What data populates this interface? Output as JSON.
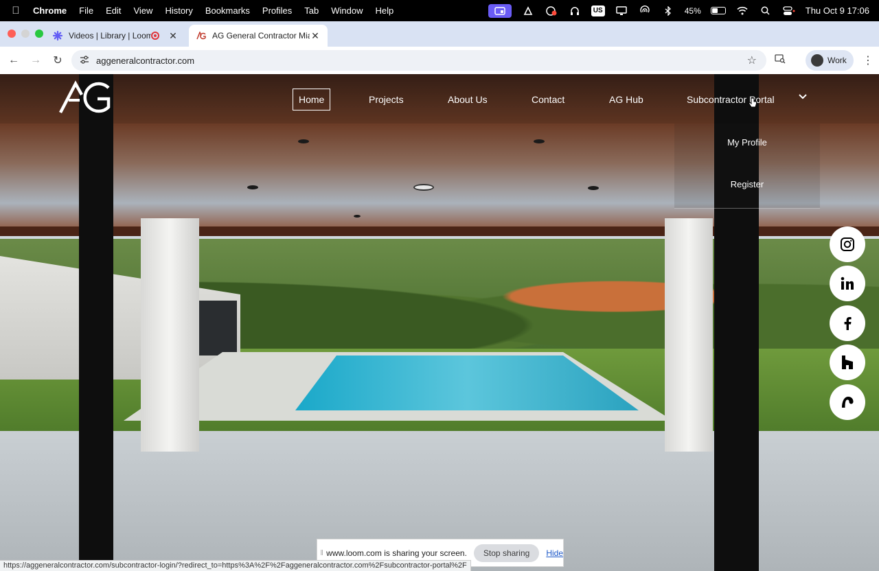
{
  "menubar": {
    "app_name": "Chrome",
    "items": [
      "File",
      "Edit",
      "View",
      "History",
      "Bookmarks",
      "Profiles",
      "Tab",
      "Window",
      "Help"
    ],
    "status_icons": [
      "loom-icon",
      "creative-cloud-icon",
      "screen-record-icon",
      "headphones-icon",
      "input-source-icon",
      "display-icon",
      "airdrop-icon",
      "bluetooth-icon",
      "wifi-icon",
      "search-icon",
      "control-center-icon"
    ],
    "input_source": "US",
    "battery_percent": "45%",
    "battery_level": 0.45,
    "clock": "Thu Oct 9  17:06"
  },
  "browser": {
    "tabs": [
      {
        "title": "Videos | Library | Loom",
        "active": false
      },
      {
        "title": "AG General Contractor Miami",
        "active": true
      }
    ],
    "url": "aggeneralcontractor.com",
    "profile_label": "Work"
  },
  "site": {
    "logo_text": "AG",
    "nav": [
      {
        "label": "Home",
        "active": true
      },
      {
        "label": "Projects",
        "active": false
      },
      {
        "label": "About Us",
        "active": false
      },
      {
        "label": "Contact",
        "active": false
      },
      {
        "label": "AG Hub",
        "active": false
      },
      {
        "label": "Subcontractor Portal",
        "active": false
      }
    ],
    "dropdown": [
      "My Profile",
      "Register"
    ],
    "social": [
      "instagram-icon",
      "linkedin-icon",
      "facebook-icon",
      "houzz-icon",
      "threads-icon"
    ]
  },
  "sharebar": {
    "message": "www.loom.com is sharing your screen.",
    "stop_label": "Stop sharing",
    "hide_label": "Hide"
  },
  "status_url": "https://aggeneralcontractor.com/subcontractor-login/?redirect_to=https%3A%2F%2Faggeneralcontractor.com%2Fsubcontractor-portal%2F"
}
